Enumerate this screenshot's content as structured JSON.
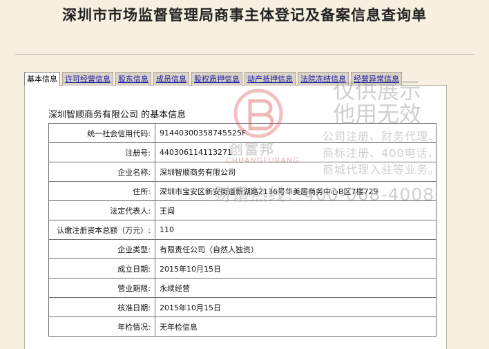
{
  "page": {
    "title": "深圳市市场监督管理局商事主体登记及备案信息查询单"
  },
  "tabs": [
    {
      "label": "基本信息",
      "active": true
    },
    {
      "label": "许可经营信息"
    },
    {
      "label": "股东信息"
    },
    {
      "label": "成员信息"
    },
    {
      "label": "股权质押信息"
    },
    {
      "label": "动产抵押信息"
    },
    {
      "label": "法院冻结信息"
    },
    {
      "label": "经营异常信息"
    }
  ],
  "company": {
    "heading": "深圳智顺商务有限公司 的基本信息"
  },
  "info_rows": [
    {
      "label": "统一社会信用代码:",
      "value": "91440300358745525F"
    },
    {
      "label": "注册号:",
      "value": "440306114113271"
    },
    {
      "label": "企业名称:",
      "value": "深圳智顺商务有限公司"
    },
    {
      "label": "住所:",
      "value": "深圳市宝安区新安街道新湖路2136号华美居商务中心B区7楼729"
    },
    {
      "label": "法定代表人:",
      "value": "王闯"
    },
    {
      "label": "认缴注册资本总额（万元）:",
      "value": "110"
    },
    {
      "label": "企业类型:",
      "value": "有限责任公司（自然人独资）"
    },
    {
      "label": "成立日期:",
      "value": "2015年10月15日"
    },
    {
      "label": "营业期限:",
      "value": "永续经营"
    },
    {
      "label": "核准日期:",
      "value": "2015年10月15日"
    },
    {
      "label": "年检情况:",
      "value": "无年检信息"
    }
  ],
  "watermark": {
    "brand": "创富邦",
    "brand_en": "CHUANGFUBANG",
    "stamp_line1": "仅供展示",
    "stamp_line2": "他用无效",
    "services_line1": "公司注册、财务代理、",
    "services_line2": "商标注册、400电话、",
    "services_line3": "商城代理入驻等业务。",
    "hotline": "财富热线：400-068-4008",
    "logo_color": "#d94a4a"
  }
}
